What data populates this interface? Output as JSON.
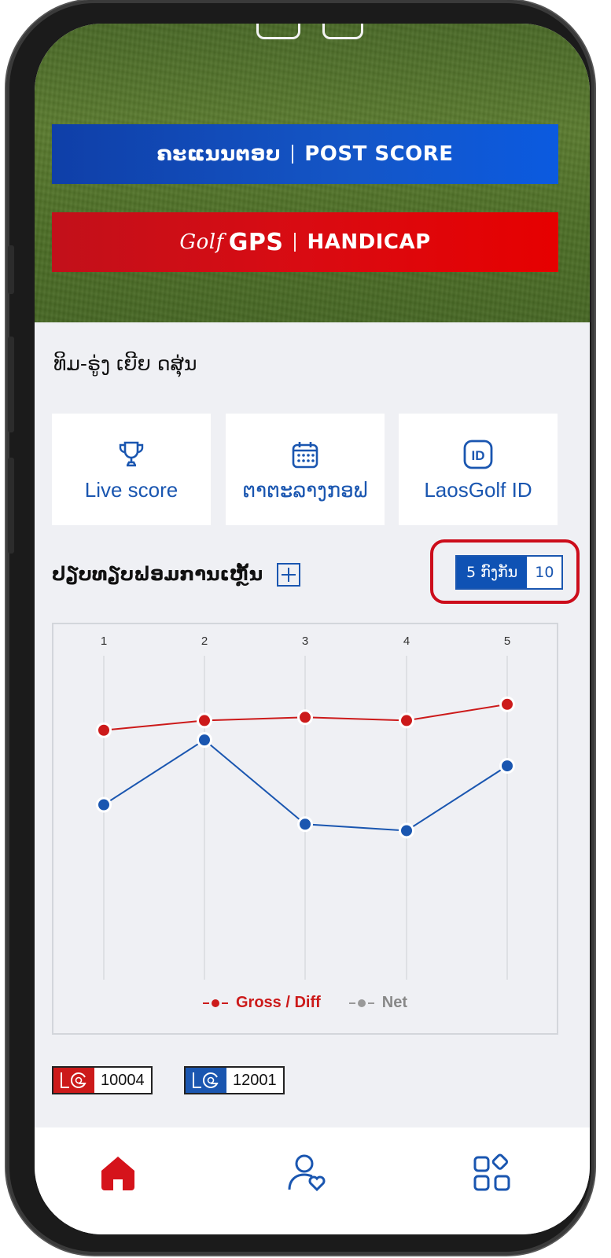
{
  "banners": {
    "post_score_lao": "ຄະແນນຕອບ",
    "post_score": "POST SCORE",
    "golf_script": "Golf",
    "gps": "GPS",
    "handicap": "HANDICAP"
  },
  "greeting": "ທິມ-ຣູ່ງ ເຍີຍ ດສຸ່ນ",
  "quick_links": [
    {
      "label": "Live score",
      "icon": "trophy-icon"
    },
    {
      "label": "ຕາຕະລາງກອຟ",
      "icon": "calendar-icon"
    },
    {
      "label": "LaosGolf ID",
      "icon": "id-icon"
    }
  ],
  "performance": {
    "title": "ປຽບທຽບຟອມການເຫຼັ້ນ",
    "range_options": [
      "5 ກົງກັນ",
      "10"
    ],
    "selected_range": "5 ກົງກັນ"
  },
  "chart_data": {
    "type": "line",
    "x": [
      "1",
      "2",
      "3",
      "4",
      "5"
    ],
    "series": [
      {
        "name": "Gross / Diff",
        "color": "#cc1a1a",
        "values": [
          77,
          80,
          81,
          80,
          85
        ]
      },
      {
        "name": "Net",
        "color": "#1a56b0",
        "values": [
          54,
          74,
          48,
          46,
          66
        ]
      }
    ],
    "ylim": [
      0,
      100
    ],
    "grid": "vertical",
    "legend": "bottom"
  },
  "legend": {
    "gross": "Gross / Diff",
    "net": "Net",
    "gross_color": "#cc1a1a",
    "net_color": "#888888"
  },
  "badges": [
    {
      "number": "10004",
      "color": "#cc1a1a"
    },
    {
      "number": "12001",
      "color": "#1a56b0"
    }
  ],
  "nav": [
    {
      "icon": "home-icon",
      "active": true
    },
    {
      "icon": "profile-heart-icon",
      "active": false
    },
    {
      "icon": "apps-grid-icon",
      "active": false
    }
  ]
}
